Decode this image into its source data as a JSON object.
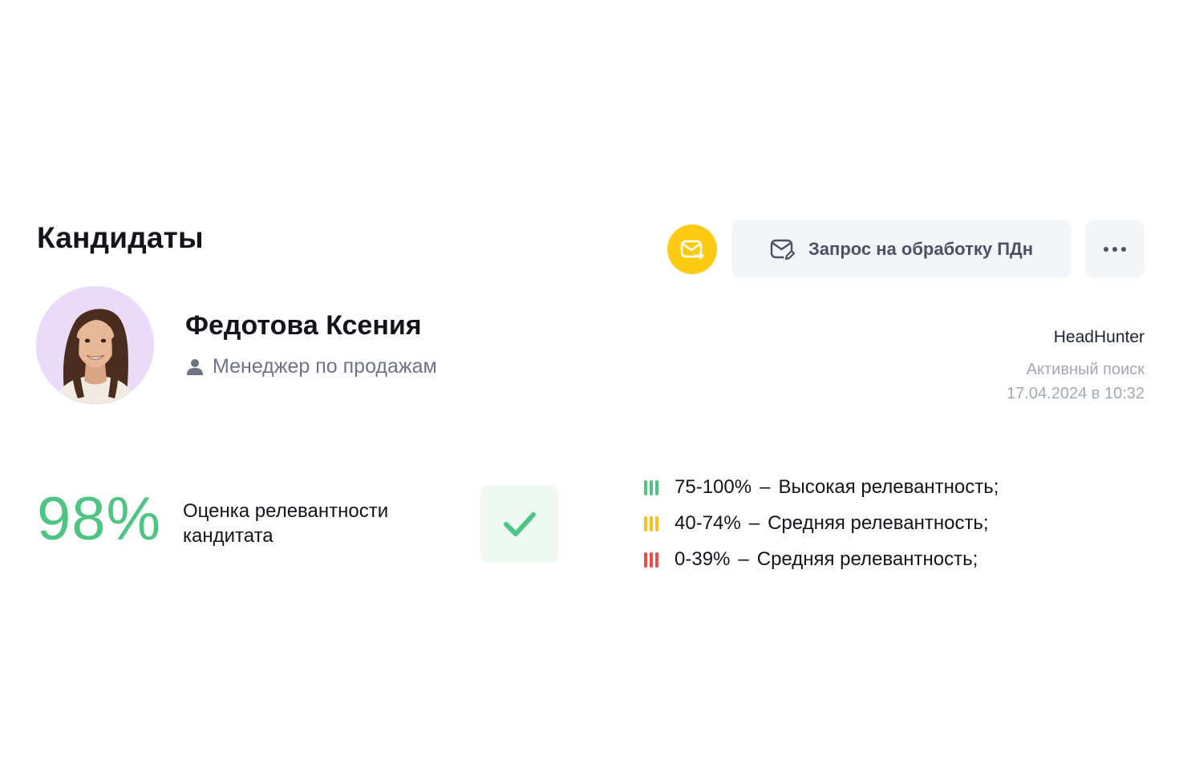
{
  "header": {
    "title": "Кандидаты",
    "mail_button_icon": "mail-forward-icon",
    "pdn_button_label": "Запрос на обработку ПДн",
    "pdn_button_icon": "mail-edit-icon",
    "more_button_icon": "more-horizontal-icon"
  },
  "candidate": {
    "avatar_icon": "candidate-photo",
    "name": "Федотова Ксения",
    "position_icon": "user-icon",
    "position": "Менеджер по продажам",
    "source": "HeadHunter",
    "status": "Активный поиск",
    "date": "17.04.2024 в 10:32"
  },
  "relevance": {
    "score": "98%",
    "label": "Оценка релевантности кандитата",
    "check_icon": "check-icon"
  },
  "legend": [
    {
      "range": "75-100%",
      "separator": "–",
      "text": "Высокая релевантность;",
      "color": "#4ec583"
    },
    {
      "range": "40-74%",
      "separator": "–",
      "text": "Средняя релевантность;",
      "color": "#f6c221"
    },
    {
      "range": "0-39%",
      "separator": "–",
      "text": "Средняя релевантность;",
      "color": "#ef4b4b"
    }
  ],
  "colors": {
    "accent_yellow": "#ffcb12",
    "score_green": "#4ec583",
    "button_bg": "#f3f6f9"
  }
}
